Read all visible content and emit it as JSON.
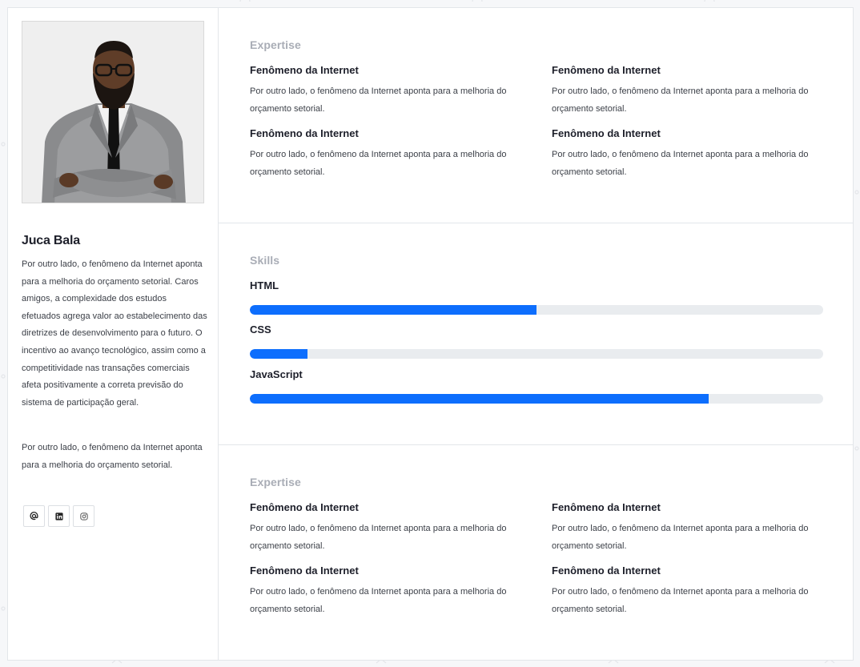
{
  "profile": {
    "name": "Juca Bala",
    "bio_paragraph_1": "Por outro lado, o fenômeno da Internet aponta para a melhoria do orçamento setorial. Caros amigos, a complexidade dos estudos efetuados agrega valor ao estabelecimento das diretrizes de desenvolvimento para o futuro. O incentivo ao avanço tecnológico, assim como a competitividade nas transações comerciais afeta positivamente a correta previsão do sistema de participação geral.",
    "bio_paragraph_2": "Por outro lado, o fenômeno da Internet aponta para a melhoria do orçamento setorial.",
    "social_icons": [
      "at-icon",
      "linkedin-icon",
      "instagram-icon"
    ]
  },
  "expertise_top": {
    "title": "Expertise",
    "items": [
      {
        "title": "Fenômeno da Internet",
        "text": "Por outro lado, o fenômeno da Internet aponta para a melhoria do orçamento setorial."
      },
      {
        "title": "Fenômeno da Internet",
        "text": "Por outro lado, o fenômeno da Internet aponta para a melhoria do orçamento setorial."
      },
      {
        "title": "Fenômeno da Internet",
        "text": "Por outro lado, o fenômeno da Internet aponta para a melhoria do orçamento setorial."
      },
      {
        "title": "Fenômeno da Internet",
        "text": "Por outro lado, o fenômeno da Internet aponta para a melhoria do orçamento setorial."
      }
    ]
  },
  "skills": {
    "title": "Skills",
    "items": [
      {
        "label": "HTML",
        "level": 0.5
      },
      {
        "label": "CSS",
        "level": 0.1
      },
      {
        "label": "JavaScript",
        "level": 0.8
      }
    ],
    "bar_color": "#0d6efd",
    "track_color": "#e9ecef"
  },
  "expertise_bottom": {
    "title": "Expertise",
    "items": [
      {
        "title": "Fenômeno da Internet",
        "text": "Por outro lado, o fenômeno da Internet aponta para a melhoria do orçamento setorial."
      },
      {
        "title": "Fenômeno da Internet",
        "text": "Por outro lado, o fenômeno da Internet aponta para a melhoria do orçamento setorial."
      },
      {
        "title": "Fenômeno da Internet",
        "text": "Por outro lado, o fenômeno da Internet aponta para a melhoria do orçamento setorial."
      },
      {
        "title": "Fenômeno da Internet",
        "text": "Por outro lado, o fenômeno da Internet aponta para a melhoria do orçamento setorial."
      }
    ]
  }
}
